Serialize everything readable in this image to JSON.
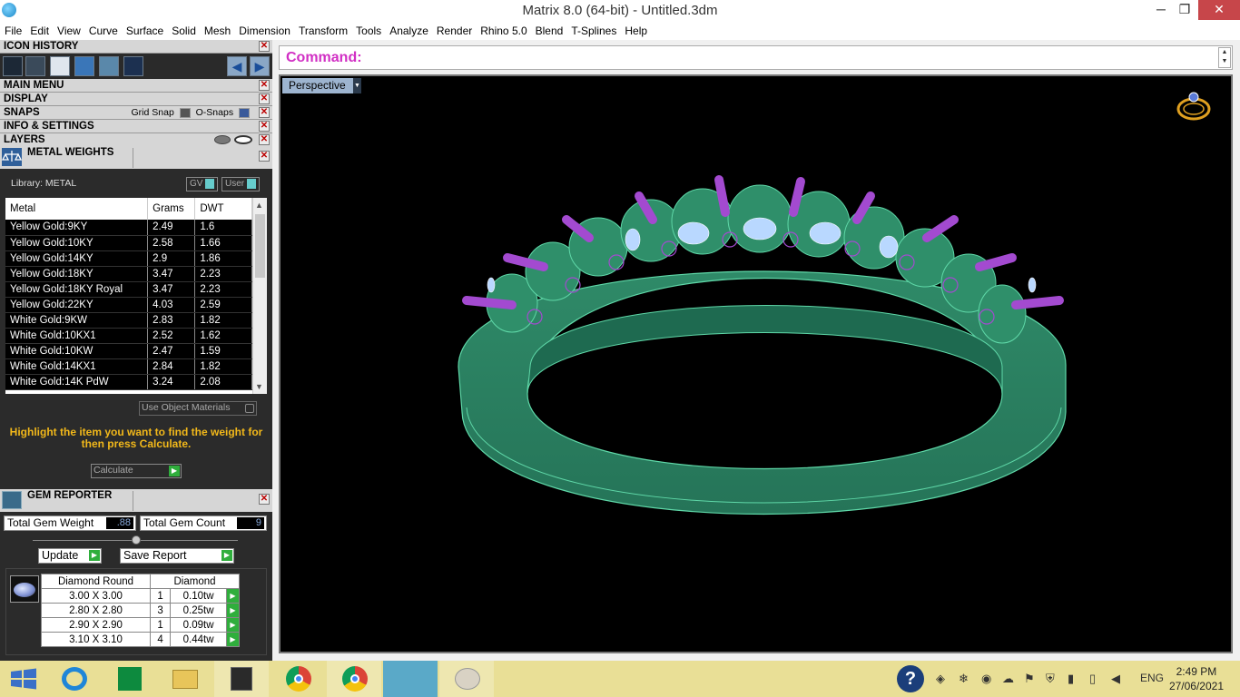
{
  "window": {
    "title": "Matrix 8.0 (64-bit) - Untitled.3dm",
    "minimize": "─",
    "restore": "❐",
    "close": "✕"
  },
  "menu": [
    "File",
    "Edit",
    "View",
    "Curve",
    "Surface",
    "Solid",
    "Mesh",
    "Dimension",
    "Transform",
    "Tools",
    "Analyze",
    "Render",
    "Rhino 5.0",
    "Blend",
    "T-Splines",
    "Help"
  ],
  "panel": {
    "icon_history": "ICON HISTORY",
    "main_menu": "MAIN MENU",
    "display": "DISPLAY",
    "snaps": "SNAPS",
    "grid_snap": "Grid Snap",
    "osnaps": "O-Snaps",
    "info_settings": "INFO & SETTINGS",
    "layers": "LAYERS",
    "close_glyph": "✕"
  },
  "metal_weights": {
    "title": "METAL WEIGHTS",
    "library": "Library: METAL",
    "gv": "GV",
    "user": "User",
    "columns": [
      "Metal",
      "Grams",
      "DWT"
    ],
    "rows": [
      [
        "Yellow Gold:9KY",
        "2.49",
        "1.6"
      ],
      [
        "Yellow Gold:10KY",
        "2.58",
        "1.66"
      ],
      [
        "Yellow Gold:14KY",
        "2.9",
        "1.86"
      ],
      [
        "Yellow Gold:18KY",
        "3.47",
        "2.23"
      ],
      [
        "Yellow Gold:18KY Royal",
        "3.47",
        "2.23"
      ],
      [
        "Yellow Gold:22KY",
        "4.03",
        "2.59"
      ],
      [
        "White Gold:9KW",
        "2.83",
        "1.82"
      ],
      [
        "White Gold:10KX1",
        "2.52",
        "1.62"
      ],
      [
        "White Gold:10KW",
        "2.47",
        "1.59"
      ],
      [
        "White Gold:14KX1",
        "2.84",
        "1.82"
      ],
      [
        "White Gold:14K PdW",
        "3.24",
        "2.08"
      ]
    ],
    "use_object_materials": "Use Object Materials",
    "hint": "Highlight the item you want to find the weight for then press Calculate.",
    "calculate": "Calculate"
  },
  "gem_reporter": {
    "title": "GEM REPORTER",
    "total_weight_label": "Total Gem Weight",
    "total_weight": ".88",
    "total_count_label": "Total Gem Count",
    "total_count": "9",
    "update": "Update",
    "save_report": "Save Report",
    "columns": [
      "Diamond Round",
      "Diamond"
    ],
    "rows": [
      [
        "3.00 X 3.00",
        "1",
        "0.10tw"
      ],
      [
        "2.80 X 2.80",
        "3",
        "0.25tw"
      ],
      [
        "2.90 X 2.90",
        "1",
        "0.09tw"
      ],
      [
        "3.10 X 3.10",
        "4",
        "0.44tw"
      ]
    ]
  },
  "command": {
    "label": "Command:"
  },
  "viewport": {
    "label": "Perspective"
  },
  "taskbar": {
    "language": "ENG",
    "time": "2:49 PM",
    "date": "27/06/2021"
  },
  "colors": {
    "metal": "#2f8f6a",
    "prongs": "#9b3fc0",
    "hint": "#f2b81a",
    "command": "#d12fc4"
  }
}
